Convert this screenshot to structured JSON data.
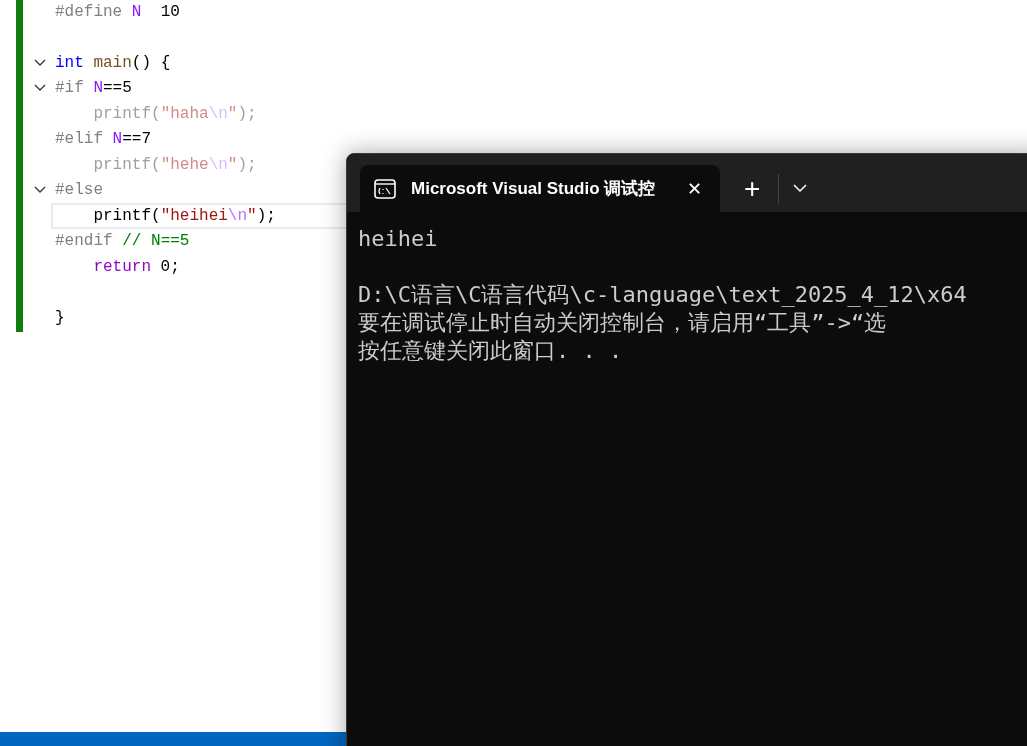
{
  "editor": {
    "blocks": [
      [
        {
          "fold": false,
          "inactive": false,
          "current": false,
          "tokens": [
            {
              "kind": "preproc",
              "text": "#define "
            },
            {
              "kind": "macro",
              "text": "N"
            },
            {
              "kind": "plain",
              "text": "  10"
            }
          ]
        }
      ],
      [
        {
          "fold": true,
          "inactive": false,
          "current": false,
          "tokens": [
            {
              "kind": "keyword",
              "text": "int"
            },
            {
              "kind": "func",
              "text": " main"
            },
            {
              "kind": "plain",
              "text": "() {"
            }
          ]
        },
        {
          "fold": true,
          "inactive": false,
          "current": false,
          "tokens": [
            {
              "kind": "preproc",
              "text": "#if "
            },
            {
              "kind": "macro",
              "text": "N"
            },
            {
              "kind": "plain",
              "text": "==5"
            }
          ]
        },
        {
          "fold": false,
          "inactive": true,
          "current": false,
          "tokens": [
            {
              "kind": "plain",
              "text": "    printf("
            },
            {
              "kind": "string",
              "text": "\"haha"
            },
            {
              "kind": "escape",
              "text": "\\n"
            },
            {
              "kind": "string",
              "text": "\""
            },
            {
              "kind": "plain",
              "text": ");"
            }
          ]
        },
        {
          "fold": false,
          "inactive": false,
          "current": false,
          "tokens": [
            {
              "kind": "preproc",
              "text": "#elif "
            },
            {
              "kind": "macro",
              "text": "N"
            },
            {
              "kind": "plain",
              "text": "==7"
            }
          ]
        },
        {
          "fold": false,
          "inactive": true,
          "current": false,
          "tokens": [
            {
              "kind": "plain",
              "text": "    printf("
            },
            {
              "kind": "string",
              "text": "\"hehe"
            },
            {
              "kind": "escape",
              "text": "\\n"
            },
            {
              "kind": "string",
              "text": "\""
            },
            {
              "kind": "plain",
              "text": ");"
            }
          ]
        },
        {
          "fold": true,
          "inactive": false,
          "current": false,
          "tokens": [
            {
              "kind": "preproc",
              "text": "#else"
            }
          ]
        },
        {
          "fold": false,
          "inactive": false,
          "current": true,
          "tokens": [
            {
              "kind": "plain",
              "text": "    printf("
            },
            {
              "kind": "string",
              "text": "\"heihei"
            },
            {
              "kind": "escape",
              "text": "\\n"
            },
            {
              "kind": "string",
              "text": "\""
            },
            {
              "kind": "plain",
              "text": ");"
            }
          ]
        },
        {
          "fold": false,
          "inactive": false,
          "current": false,
          "tokens": [
            {
              "kind": "preproc",
              "text": "#endif "
            },
            {
              "kind": "comment",
              "text": "// N==5"
            }
          ]
        },
        {
          "fold": false,
          "inactive": false,
          "current": false,
          "tokens": [
            {
              "kind": "control",
              "text": "    return"
            },
            {
              "kind": "plain",
              "text": " 0;"
            }
          ]
        }
      ],
      [
        {
          "fold": false,
          "inactive": false,
          "current": false,
          "tokens": [
            {
              "kind": "plain",
              "text": "}"
            }
          ]
        }
      ]
    ]
  },
  "terminal": {
    "tab": {
      "title": "Microsoft Visual Studio 调试控",
      "close": "✕",
      "selected": true
    },
    "new_tab": "+",
    "output": [
      [
        "heihei"
      ],
      [
        "D:\\C语言\\C语言代码\\c-language\\text_2025_4_12\\x64",
        "要在调试停止时自动关闭控制台，请启用“工具”->“选",
        "按任意键关闭此窗口. . ."
      ]
    ]
  }
}
